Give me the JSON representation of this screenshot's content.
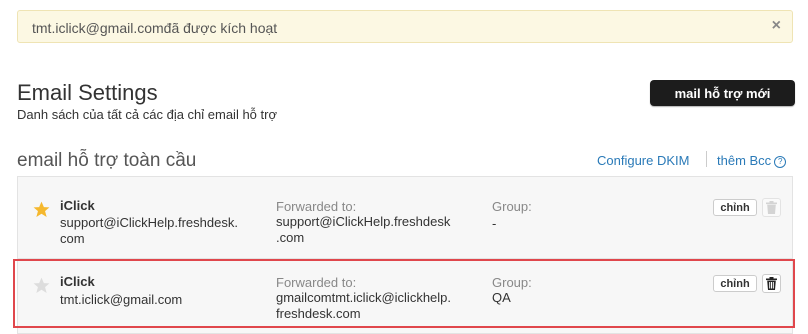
{
  "alert": {
    "message": "tmt.iclick@gmail.comđã được kích hoạt",
    "close_icon": "×"
  },
  "header": {
    "title": "Email Settings",
    "subtitle": "Danh sách của tất cả các địa chỉ email hỗ trợ",
    "new_button_label": "mail hỗ trợ mới"
  },
  "section": {
    "title": "email hỗ trợ toàn cầu",
    "configure_dkim_label": "Configure DKIM",
    "add_bcc_label": "thêm Bcc",
    "help_icon": "?"
  },
  "emails": [
    {
      "name": "iClick",
      "email_line1": "support@iClickHelp.freshdesk.",
      "email_line2": "com",
      "forwarded_label": "Forwarded to:",
      "forwarded_line1": "support@iClickHelp.freshdesk",
      "forwarded_line2": ".com",
      "group_label": "Group:",
      "group_value": "-",
      "edit_label": "chỉnh",
      "primary": true,
      "star_color": "#f5b82e"
    },
    {
      "name": "iClick",
      "email_line1": "tmt.iclick@gmail.com",
      "email_line2": "",
      "forwarded_label": "Forwarded to:",
      "forwarded_line1": "gmailcomtmt.iclick@iclickhelp.",
      "forwarded_line2": "freshdesk.com",
      "group_label": "Group:",
      "group_value": "QA",
      "edit_label": "chỉnh",
      "primary": false,
      "star_color": "#dddddd"
    }
  ],
  "colors": {
    "alert_bg": "#fcf8e3",
    "link": "#2a7ab8",
    "highlight": "#e0474c",
    "button_dark": "#1c1c1c"
  }
}
